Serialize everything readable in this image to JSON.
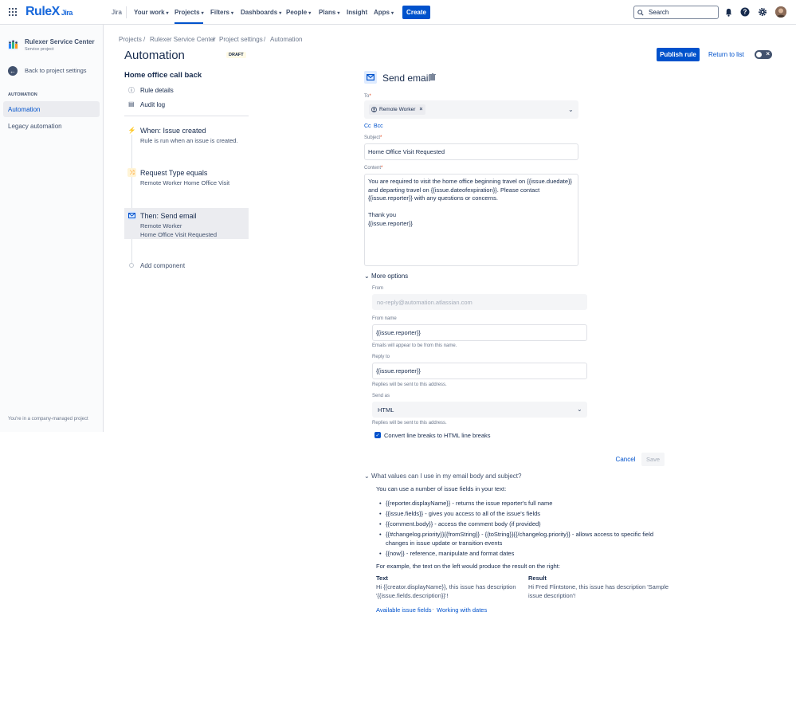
{
  "topnav": {
    "brand": "RuleX",
    "brand_suffix": "Jira",
    "items": {
      "jira": "Jira",
      "your_work": "Your work",
      "projects": "Projects",
      "filters": "Filters",
      "dashboards": "Dashboards",
      "people": "People",
      "plans": "Plans",
      "insight": "Insight",
      "apps": "Apps"
    },
    "create_label": "Create",
    "search_placeholder": "Search"
  },
  "sidebar": {
    "project_name": "Rulexer Service Center",
    "project_type": "Service project",
    "back_label": "Back to project settings",
    "section": "AUTOMATION",
    "items": [
      "Automation",
      "Legacy automation"
    ],
    "footer": "You're in a company-managed project"
  },
  "breadcrumb": [
    "Projects",
    "Rulexer Service Center",
    "Project settings",
    "Automation"
  ],
  "header": {
    "title": "Automation",
    "badge": "DRAFT",
    "publish_label": "Publish rule",
    "return_label": "Return to list"
  },
  "rule": {
    "title": "Home office call back",
    "links": [
      "Rule details",
      "Audit log"
    ],
    "steps": [
      {
        "title": "When: Issue created",
        "sub": [
          "Rule is run when an issue is created."
        ]
      },
      {
        "title": "Request Type equals",
        "sub": [
          "Remote Worker Home Office Visit"
        ]
      },
      {
        "title": "Then: Send email",
        "sub": [
          "Remote Worker",
          "Home Office Visit Requested"
        ]
      }
    ],
    "add_component": "Add component"
  },
  "form": {
    "title": "Send email",
    "to_label": "To",
    "to_chip": "Remote Worker",
    "cc": "Cc",
    "bcc": "Bcc",
    "subject_label": "Subject",
    "subject_value": "Home Office Visit Requested",
    "content_label": "Content",
    "content_lines": [
      "You are required to visit the home office beginning travel on {{issue.duedate}}",
      "and departing travel on {{issue.dateofexpiration}}. Please contact",
      "{{issue.reporter}} with any questions or concerns.",
      "",
      "Thank you",
      "{{issue.reporter}}"
    ],
    "more_options": "More options",
    "from_label": "From",
    "from_placeholder": "no-reply@automation.atlassian.com",
    "from_name_label": "From name",
    "from_name_value": "{{issue.reporter}}",
    "from_name_help": "Emails will appear to be from this name.",
    "reply_to_label": "Reply to",
    "reply_to_value": "{{issue.reporter}}",
    "reply_to_help": "Replies will be sent to this address.",
    "send_as_label": "Send as",
    "send_as_value": "HTML",
    "send_as_help": "Replies will be sent to this address.",
    "checkbox_label": "Convert line breaks to HTML line breaks",
    "cancel_label": "Cancel",
    "save_label": "Save"
  },
  "help": {
    "question": "What values can I use in my email body and subject?",
    "intro": "You can use a number of issue fields in your text:",
    "items": [
      "{{reporter.displayName}} - returns the issue reporter's full name",
      "{{issue.fields}} - gives you access to all of the issue's fields",
      "{{comment.body}} - access the comment body (if provided)",
      "{{#changelog.priority}}{{fromString}} - {{toString}}{{/changelog.priority}} - allows access to specific field changes in issue update or transition events",
      "{{now}} - reference, manipulate and format dates"
    ],
    "example_intro": "For example, the text on the left would produce the result on the right:",
    "text_title": "Text",
    "text_body": "Hi {{creator.displayName}}, this issue has description '{{issue.fields.description}}'!",
    "result_title": "Result",
    "result_body": "Hi Fred Flintstone, this issue has description 'Sample issue description'!",
    "links": [
      "Available issue fields",
      "Working with dates"
    ],
    "link_sep": "·"
  },
  "colors": {
    "accent": "#0052cc",
    "draft_bg": "#fffae6",
    "trigger": "#36b37e",
    "condition": "#ffab00"
  }
}
